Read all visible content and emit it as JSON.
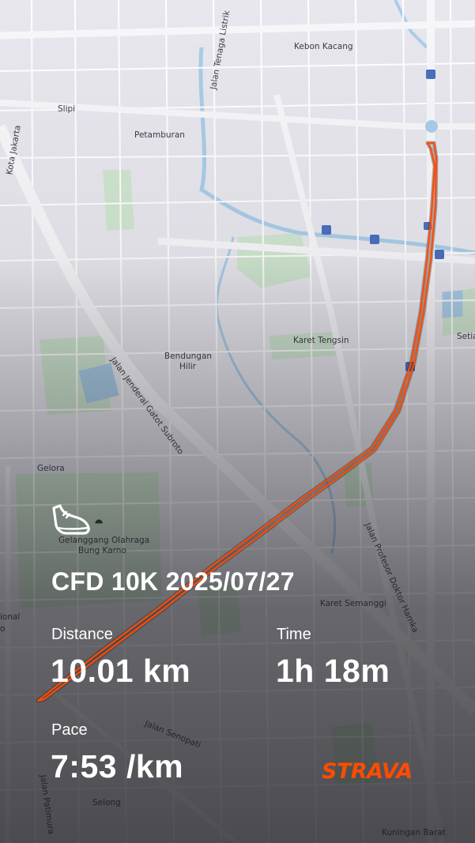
{
  "activity": {
    "title": "CFD 10K 2025/07/27",
    "stats": {
      "distance_label": "Distance",
      "distance_value": "10.01 km",
      "time_label": "Time",
      "time_value": "1h 18m",
      "pace_label": "Pace",
      "pace_value": "7:53 /km"
    },
    "activity_icon": "running-shoe-icon",
    "route_color": "#fc4c02"
  },
  "brand": {
    "name": "STRAVA",
    "color": "#fc4c02"
  },
  "map": {
    "labels": {
      "kebon_kacang": "Kebon Kacang",
      "slipi": "Slipi",
      "petamburan": "Petamburan",
      "jalan_tenaga_listrik": "Jalan Tenaga Listrik",
      "kota_jakarta": "Kota Jakarta",
      "karet_tengsin": "Karet Tengsin",
      "setia": "Setia",
      "bendungan": "Bendungan",
      "hilir": "Hilir",
      "jalan_gatot_subroto": "Jalan Jenderal Gatot Subroto",
      "gelora": "Gelora",
      "gelanggang_1": "Gelanggang Olahraga",
      "gelanggang_2": "Bung Karno",
      "karet_semanggi": "Karet Semanggi",
      "jalan_hamka": "Jalan Profesor Doktor Hamka",
      "ional": "ional",
      "o": "o",
      "jalan_senopati": "Jalan Senopati",
      "jalan_patimura": "Jalan Patimura",
      "selong": "Selong",
      "kuningan_barat": "Kuningan Barat"
    }
  }
}
